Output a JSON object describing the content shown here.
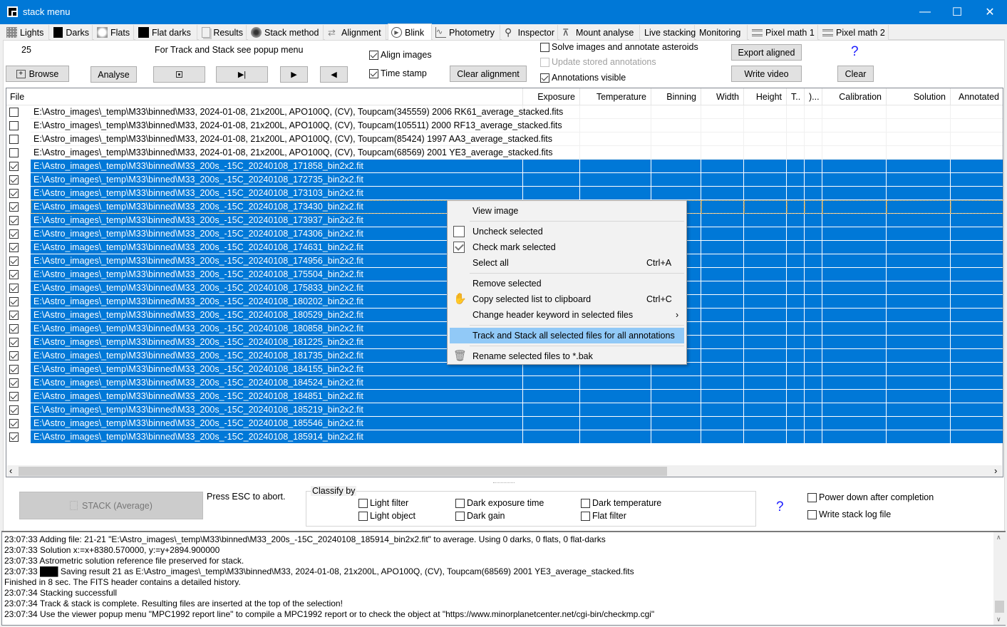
{
  "window": {
    "title": "stack menu",
    "minimize": "—",
    "maximize": "☐",
    "close": "✕"
  },
  "tabs": [
    {
      "label": "Lights",
      "icon": "lights-icon"
    },
    {
      "label": "Darks",
      "icon": "darks-icon"
    },
    {
      "label": "Flats",
      "icon": "flats-icon"
    },
    {
      "label": "Flat darks",
      "icon": "flat-darks-icon"
    },
    {
      "label": "Results",
      "icon": "results-icon"
    },
    {
      "label": "Stack method",
      "icon": "stack-method-icon"
    },
    {
      "label": "Alignment",
      "icon": "alignment-icon"
    },
    {
      "label": "Blink",
      "icon": "blink-icon",
      "active": true
    },
    {
      "label": "Photometry",
      "icon": "photometry-icon"
    },
    {
      "label": "Inspector",
      "icon": "inspector-icon"
    },
    {
      "label": "Mount analyse",
      "icon": "mount-analyse-icon"
    },
    {
      "label": "Live stacking"
    },
    {
      "label": "Monitoring"
    },
    {
      "label": "Pixel math 1",
      "icon": "pixel-math-icon"
    },
    {
      "label": "Pixel math 2",
      "icon": "pixel-math-icon"
    }
  ],
  "toolbar": {
    "count": "25",
    "hint": "For Track and Stack see popup menu",
    "browse": "Browse",
    "analyse": "Analyse",
    "stop_glyph": "■",
    "step_glyph": "▶|",
    "play_glyph": "▶",
    "back_glyph": "◀",
    "align_images": {
      "label": "Align images",
      "checked": true
    },
    "time_stamp": {
      "label": "Time stamp",
      "checked": true
    },
    "clear_alignment": "Clear alignment",
    "solve_annotate": {
      "label": "Solve images and annotate asteroids",
      "checked": false
    },
    "update_annotations": {
      "label": "Update stored annotations",
      "checked": false,
      "disabled": true
    },
    "annotations_visible": {
      "label": "Annotations visible",
      "checked": true
    },
    "export_aligned": "Export aligned",
    "write_video": "Write video",
    "help": "?",
    "clear": "Clear"
  },
  "table": {
    "columns": [
      "File",
      "Exposure",
      "Temperature",
      "Binning",
      "Width",
      "Height",
      "T..",
      ")...",
      "Calibration",
      "Solution",
      "Annotated"
    ],
    "rows": [
      {
        "checked": false,
        "selected": false,
        "file": "E:\\Astro_images\\_temp\\M33\\binned\\M33, 2024-01-08, 21x200L, APO100Q, (CV), Toupcam(345559) 2006 RK61_average_stacked.fits"
      },
      {
        "checked": false,
        "selected": false,
        "file": "E:\\Astro_images\\_temp\\M33\\binned\\M33, 2024-01-08, 21x200L, APO100Q, (CV), Toupcam(105511) 2000 RF13_average_stacked.fits"
      },
      {
        "checked": false,
        "selected": false,
        "file": "E:\\Astro_images\\_temp\\M33\\binned\\M33, 2024-01-08, 21x200L, APO100Q, (CV), Toupcam(85424) 1997 AA3_average_stacked.fits"
      },
      {
        "checked": false,
        "selected": false,
        "file": "E:\\Astro_images\\_temp\\M33\\binned\\M33, 2024-01-08, 21x200L, APO100Q, (CV), Toupcam(68569) 2001 YE3_average_stacked.fits"
      },
      {
        "checked": true,
        "selected": true,
        "file": "E:\\Astro_images\\_temp\\M33\\binned\\M33_200s_-15C_20240108_171858_bin2x2.fit"
      },
      {
        "checked": true,
        "selected": true,
        "file": "E:\\Astro_images\\_temp\\M33\\binned\\M33_200s_-15C_20240108_172735_bin2x2.fit"
      },
      {
        "checked": true,
        "selected": true,
        "file": "E:\\Astro_images\\_temp\\M33\\binned\\M33_200s_-15C_20240108_173103_bin2x2.fit"
      },
      {
        "checked": true,
        "selected": true,
        "focused": true,
        "file": "E:\\Astro_images\\_temp\\M33\\binned\\M33_200s_-15C_20240108_173430_bin2x2.fit"
      },
      {
        "checked": true,
        "selected": true,
        "file": "E:\\Astro_images\\_temp\\M33\\binned\\M33_200s_-15C_20240108_173937_bin2x2.fit"
      },
      {
        "checked": true,
        "selected": true,
        "file": "E:\\Astro_images\\_temp\\M33\\binned\\M33_200s_-15C_20240108_174306_bin2x2.fit"
      },
      {
        "checked": true,
        "selected": true,
        "file": "E:\\Astro_images\\_temp\\M33\\binned\\M33_200s_-15C_20240108_174631_bin2x2.fit"
      },
      {
        "checked": true,
        "selected": true,
        "file": "E:\\Astro_images\\_temp\\M33\\binned\\M33_200s_-15C_20240108_174956_bin2x2.fit"
      },
      {
        "checked": true,
        "selected": true,
        "file": "E:\\Astro_images\\_temp\\M33\\binned\\M33_200s_-15C_20240108_175504_bin2x2.fit"
      },
      {
        "checked": true,
        "selected": true,
        "file": "E:\\Astro_images\\_temp\\M33\\binned\\M33_200s_-15C_20240108_175833_bin2x2.fit"
      },
      {
        "checked": true,
        "selected": true,
        "file": "E:\\Astro_images\\_temp\\M33\\binned\\M33_200s_-15C_20240108_180202_bin2x2.fit"
      },
      {
        "checked": true,
        "selected": true,
        "file": "E:\\Astro_images\\_temp\\M33\\binned\\M33_200s_-15C_20240108_180529_bin2x2.fit"
      },
      {
        "checked": true,
        "selected": true,
        "file": "E:\\Astro_images\\_temp\\M33\\binned\\M33_200s_-15C_20240108_180858_bin2x2.fit"
      },
      {
        "checked": true,
        "selected": true,
        "file": "E:\\Astro_images\\_temp\\M33\\binned\\M33_200s_-15C_20240108_181225_bin2x2.fit"
      },
      {
        "checked": true,
        "selected": true,
        "file": "E:\\Astro_images\\_temp\\M33\\binned\\M33_200s_-15C_20240108_181735_bin2x2.fit"
      },
      {
        "checked": true,
        "selected": true,
        "file": "E:\\Astro_images\\_temp\\M33\\binned\\M33_200s_-15C_20240108_184155_bin2x2.fit"
      },
      {
        "checked": true,
        "selected": true,
        "file": "E:\\Astro_images\\_temp\\M33\\binned\\M33_200s_-15C_20240108_184524_bin2x2.fit"
      },
      {
        "checked": true,
        "selected": true,
        "file": "E:\\Astro_images\\_temp\\M33\\binned\\M33_200s_-15C_20240108_184851_bin2x2.fit"
      },
      {
        "checked": true,
        "selected": true,
        "file": "E:\\Astro_images\\_temp\\M33\\binned\\M33_200s_-15C_20240108_185219_bin2x2.fit"
      },
      {
        "checked": true,
        "selected": true,
        "file": "E:\\Astro_images\\_temp\\M33\\binned\\M33_200s_-15C_20240108_185546_bin2x2.fit"
      },
      {
        "checked": true,
        "selected": true,
        "file": "E:\\Astro_images\\_temp\\M33\\binned\\M33_200s_-15C_20240108_185914_bin2x2.fit"
      }
    ],
    "scroll_left": "‹",
    "scroll_right": "›"
  },
  "context_menu": {
    "items": [
      {
        "label": "View image"
      },
      {
        "separator": true
      },
      {
        "label": "Uncheck selected",
        "icon": "unchecked-box-icon"
      },
      {
        "label": "Check mark selected",
        "icon": "checked-box-icon"
      },
      {
        "label": "Select all",
        "shortcut": "Ctrl+A"
      },
      {
        "separator": true
      },
      {
        "label": "Remove selected"
      },
      {
        "label": "Copy selected list to clipboard",
        "shortcut": "Ctrl+C",
        "icon": "clipboard-icon"
      },
      {
        "label": "Change header keyword in selected files",
        "submenu": "›"
      },
      {
        "separator": true
      },
      {
        "label": "Track and Stack all selected files for all annotations",
        "highlighted": true
      },
      {
        "separator": true
      },
      {
        "label": "Rename selected files to *.bak",
        "icon": "trash-icon"
      }
    ]
  },
  "stack_panel": {
    "stack_button": "STACK (Average)",
    "abort_hint": "Press ESC to abort.",
    "classify_title": "Classify by",
    "classify": [
      {
        "label": "Light filter",
        "checked": false
      },
      {
        "label": "Light object",
        "checked": false
      },
      {
        "label": "Dark exposure time",
        "checked": false
      },
      {
        "label": "Dark gain",
        "checked": false
      },
      {
        "label": "Dark temperature",
        "checked": false
      },
      {
        "label": "Flat filter",
        "checked": false
      }
    ],
    "help": "?",
    "power_down": {
      "label": "Power down after completion",
      "checked": false
    },
    "write_log": {
      "label": "Write stack log file",
      "checked": false
    }
  },
  "log": [
    "23:07:33  Adding file: 21-21 \"E:\\Astro_images\\_temp\\M33\\binned\\M33_200s_-15C_20240108_185914_bin2x2.fit\"  to average. Using 0 darks, 0 flats, 0 flat-darks",
    "23:07:33  Solution x:=x+8380.570000,  y:=y+2894.900000",
    "23:07:33  Astrometric solution reference file preserved for stack.",
    "23:07:33  ███  Saving result 21 as E:\\Astro_images\\_temp\\M33\\binned\\M33, 2024-01-08, 21x200L, APO100Q, (CV), Toupcam(68569) 2001 YE3_average_stacked.fits",
    "Finished in 8 sec. The FITS header contains a detailed history.",
    "23:07:34  Stacking successfull",
    "23:07:34  Track & stack is complete. Resulting files are inserted at the top of the selection!",
    "23:07:34  Use the viewer popup menu \"MPC1992 report line\" to compile a MPC1992 report or to check the object at \"https://www.minorplanetcenter.net/cgi-bin/checkmp.cgi\""
  ],
  "colors": {
    "accent": "#0078d7",
    "menu_highlight": "#91c9f7",
    "help": "#1a1aff"
  }
}
